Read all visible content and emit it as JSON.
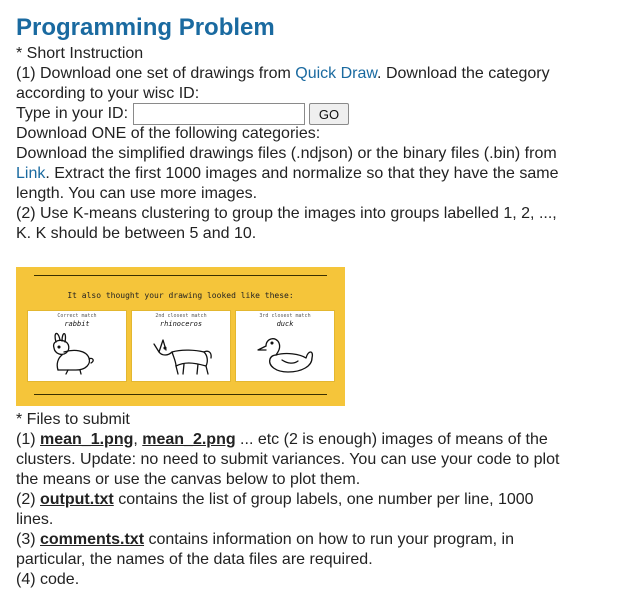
{
  "title": "Programming Problem",
  "intro": {
    "short_instruction": "* Short Instruction",
    "step1_line1_before": "(1) Download one set of drawings from ",
    "quick_draw_link": "Quick Draw",
    "step1_line1_after": ".  Download the category",
    "step1_line2": "according to your wisc ID:",
    "id_label": "Type in your ID:",
    "id_value": "",
    "go_label": "GO",
    "categories_line": "Download ONE of the following categories:",
    "files_line1": "Download the simplified drawings files (.ndjson) or the binary files (.bin) from",
    "files_link": "Link",
    "files_line2_after": ". Extract the first 1000 images and normalize so that they have the same",
    "files_line3": "length. You can use more images.",
    "step2_line1": "(2) Use K-means clustering to group the images into groups labelled 1, 2, ...,",
    "step2_line2": "K. K should be between 5 and 10."
  },
  "quickdraw_image": {
    "caption": "It also thought your drawing looked like these:",
    "cards": [
      {
        "rank": "Correct match",
        "guess": "rabbit",
        "icon": "rabbit-icon"
      },
      {
        "rank": "2nd closest match",
        "guess": "rhinoceros",
        "icon": "rhinoceros-icon"
      },
      {
        "rank": "3rd closest match",
        "guess": "duck",
        "icon": "duck-icon"
      }
    ]
  },
  "submit": {
    "heading": "* Files to submit",
    "item1_prefix": "(1) ",
    "mean1_file": "mean_1.png",
    "comma": ", ",
    "mean2_file": "mean_2.png",
    "item1_after": " ... etc (2 is enough) images of means of the",
    "item1_line2": "clusters. Update: no need to submit variances. You can use your code to plot",
    "item1_line3": "the means or use the canvas below to plot them.",
    "item2_prefix": "(2) ",
    "output_file": "output.txt",
    "item2_after": " contains the list of group labels, one number per line, 1000",
    "item2_line2": "lines.",
    "item3_prefix": "(3) ",
    "comments_file": "comments.txt",
    "item3_after": " contains information on how to run your program, in",
    "item3_line2": "particular, the names of the data files are required.",
    "item4": "(4) code."
  }
}
